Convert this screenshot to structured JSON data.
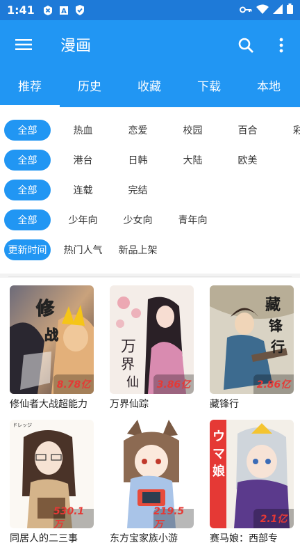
{
  "status": {
    "time": "1:41",
    "icons": [
      "x-icon",
      "a-icon",
      "shield-icon",
      "key-icon",
      "wifi-icon",
      "signal-icon",
      "battery-icon"
    ]
  },
  "appbar": {
    "title": "漫画",
    "menu_icon": "menu-icon",
    "search_icon": "search-icon",
    "more_icon": "more-vert-icon"
  },
  "tabs": [
    {
      "label": "推荐",
      "active": true
    },
    {
      "label": "历史",
      "active": false
    },
    {
      "label": "收藏",
      "active": false
    },
    {
      "label": "下载",
      "active": false
    },
    {
      "label": "本地",
      "active": false
    }
  ],
  "filters": {
    "row1": {
      "selected": "全部",
      "options": [
        "热血",
        "恋爱",
        "校园",
        "百合",
        "彩"
      ]
    },
    "row2": {
      "selected": "全部",
      "options": [
        "港台",
        "日韩",
        "大陆",
        "欧美"
      ]
    },
    "row3": {
      "selected": "全部",
      "options": [
        "连载",
        "完结"
      ]
    },
    "row4": {
      "selected": "全部",
      "options": [
        "少年向",
        "少女向",
        "青年向"
      ]
    },
    "row5": {
      "selected": "更新时间",
      "options": [
        "热门人气",
        "新品上架"
      ]
    }
  },
  "comics": [
    {
      "title": "修仙者大战超能力",
      "views": "8.78亿"
    },
    {
      "title": "万界仙踪",
      "views": "3.86亿"
    },
    {
      "title": "藏锋行",
      "views": "2.86亿"
    },
    {
      "title": "同居人的二三事",
      "views": "530.1万"
    },
    {
      "title": "东方宝家族小游",
      "views": "219.5万"
    },
    {
      "title": "赛马娘：西部专",
      "views": "2.1亿"
    }
  ],
  "colors": {
    "primary": "#2196f3",
    "statusbar": "#1e7ad8",
    "views_text": "#e53935"
  }
}
